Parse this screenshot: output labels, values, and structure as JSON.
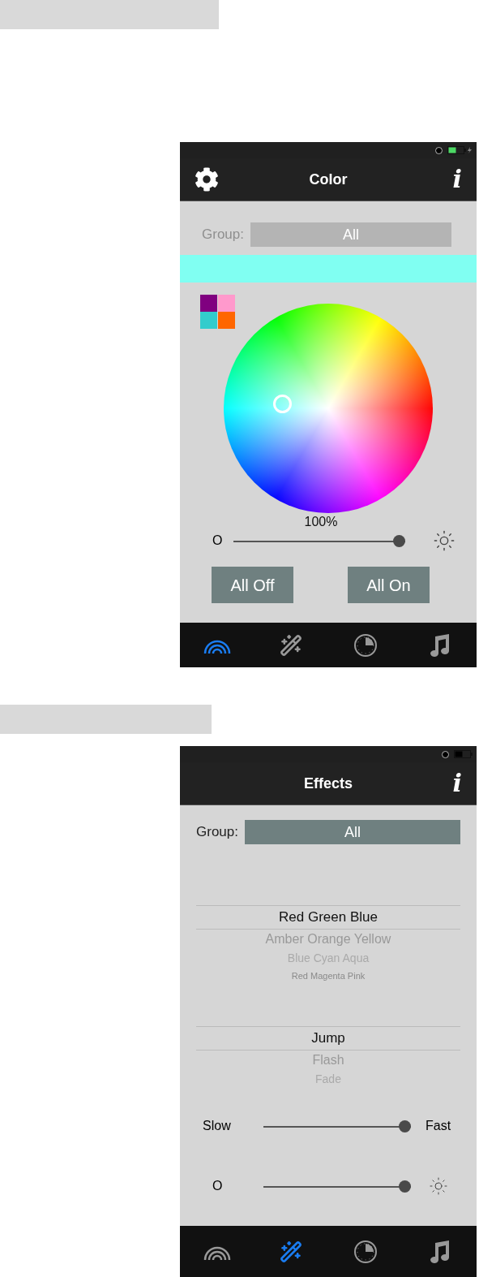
{
  "screens": [
    {
      "kind": "color",
      "charging": true,
      "title": "Color",
      "info_glyph": "i",
      "group": {
        "label": "Group:",
        "value": "All",
        "disabled": true
      },
      "swatches": [
        {
          "color": "#800080"
        },
        {
          "color": "#ff99cc"
        },
        {
          "color": "#33cccc"
        },
        {
          "color": "#ff6600"
        }
      ],
      "brightness": {
        "reading": "100%",
        "min_label": "O",
        "level": 1
      },
      "buttons": [
        "All Off",
        "All On"
      ],
      "tabs": [
        {
          "kind": "rainbow",
          "selected": true
        },
        {
          "kind": "wand",
          "selected": false
        },
        {
          "kind": "timer",
          "selected": false
        },
        {
          "kind": "music",
          "selected": false
        }
      ]
    },
    {
      "kind": "effects",
      "charging": false,
      "title": "Effects",
      "info_glyph": "i",
      "group": {
        "label": "Group:",
        "value": "All",
        "disabled": false
      },
      "pickers": [
        {
          "items": [
            {
              "label": "Red Green Blue",
              "selected": true
            },
            {
              "label": "Amber Orange Yellow",
              "selected": false
            },
            {
              "label": "Blue Cyan Aqua",
              "selected": false
            },
            {
              "label": "Red Magenta Pink",
              "selected": false
            }
          ]
        },
        {
          "items": [
            {
              "label": "Jump",
              "selected": true
            },
            {
              "label": "Flash",
              "selected": false
            },
            {
              "label": "Fade",
              "selected": false
            }
          ]
        }
      ],
      "sliders": [
        {
          "kind": "speed",
          "min_label": "Slow",
          "max_label": "Fast",
          "level": 1
        },
        {
          "kind": "brightness",
          "min_label": "O",
          "level": 1
        }
      ],
      "tabs": [
        {
          "kind": "rainbow",
          "selected": false
        },
        {
          "kind": "wand",
          "selected": true
        },
        {
          "kind": "timer",
          "selected": false
        },
        {
          "kind": "music",
          "selected": false
        }
      ]
    }
  ]
}
